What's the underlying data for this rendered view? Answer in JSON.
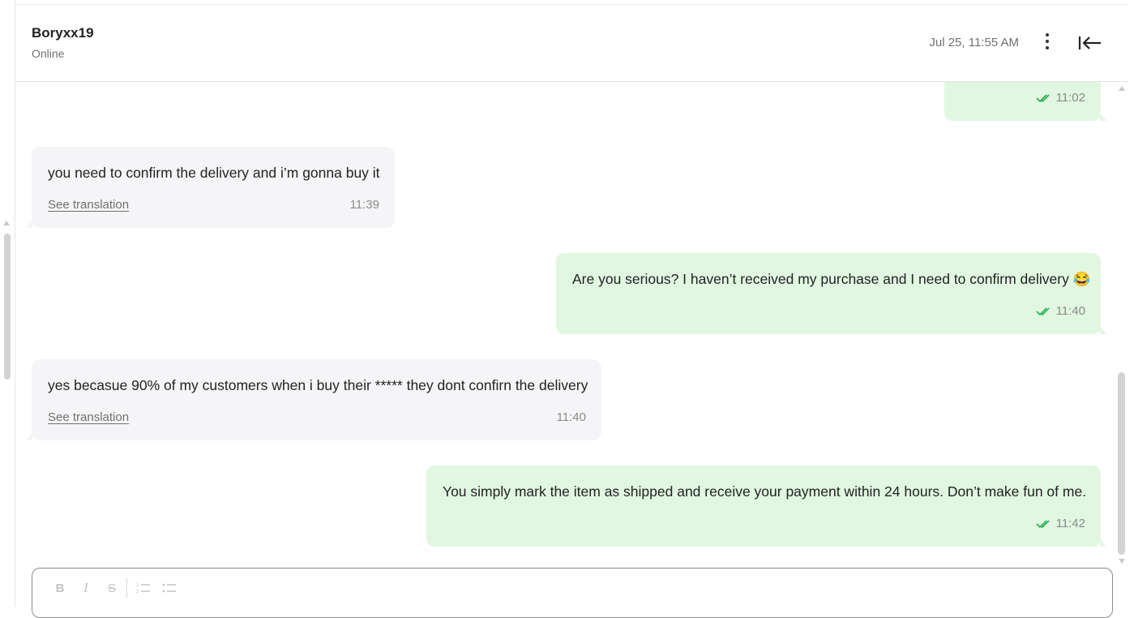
{
  "header": {
    "user_name": "Boryxx19",
    "status": "Online",
    "datetime": "Jul 25, 11:55 AM",
    "menu_icon": "more-vertical-icon",
    "collapse_icon": "collapse-left-icon"
  },
  "colors": {
    "incoming_bubble": "#f5f5f7",
    "outgoing_bubble": "#e1f7e1",
    "read_ticks": "#22b14c",
    "muted_text": "#707070"
  },
  "messages": [
    {
      "direction": "out",
      "text": "",
      "time": "11:02",
      "status": "read"
    },
    {
      "direction": "in",
      "text": "you need to confirm the delivery and i’m gonna buy it",
      "translation_link": "See translation",
      "time": "11:39"
    },
    {
      "direction": "out",
      "text": "Are you serious? I haven’t received my purchase and I need to confirm delivery 😂",
      "time": "11:40",
      "status": "read"
    },
    {
      "direction": "in",
      "text": "yes becasue 90% of my customers when i buy their ***** they dont confirn the delivery",
      "translation_link": "See translation",
      "time": "11:40"
    },
    {
      "direction": "out",
      "text": "You simply mark the item as shipped and receive your payment within 24 hours. Don’t make fun of me.",
      "time": "11:42",
      "status": "read"
    }
  ],
  "composer": {
    "toolbar": [
      {
        "icon": "bold-icon",
        "glyph": "B"
      },
      {
        "icon": "italic-icon",
        "glyph": "I"
      },
      {
        "icon": "strikethrough-icon",
        "glyph": "S"
      },
      {
        "icon": "ordered-list-icon"
      },
      {
        "icon": "bullet-list-icon"
      }
    ]
  }
}
